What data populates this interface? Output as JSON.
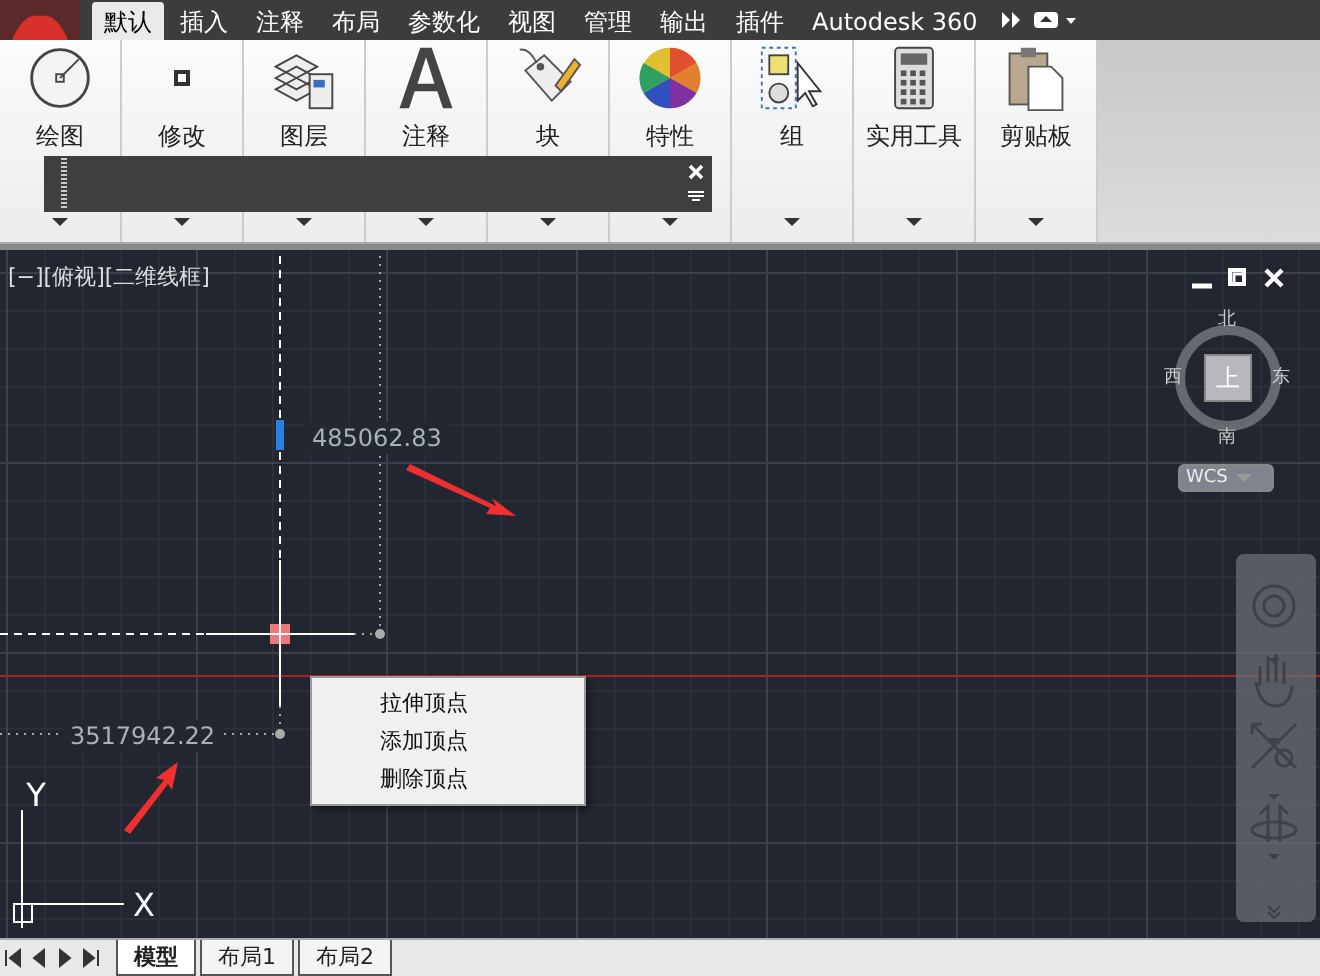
{
  "ribbon_tabs": [
    {
      "label": "默认",
      "selected": true
    },
    {
      "label": "插入",
      "selected": false
    },
    {
      "label": "注释",
      "selected": false
    },
    {
      "label": "布局",
      "selected": false
    },
    {
      "label": "参数化",
      "selected": false
    },
    {
      "label": "视图",
      "selected": false
    },
    {
      "label": "管理",
      "selected": false
    },
    {
      "label": "输出",
      "selected": false
    },
    {
      "label": "插件",
      "selected": false
    },
    {
      "label": "Autodesk 360",
      "selected": false
    }
  ],
  "ribbon_panels": [
    {
      "label": "绘图",
      "kind": "draw"
    },
    {
      "label": "修改",
      "kind": "modify"
    },
    {
      "label": "图层",
      "kind": "layers"
    },
    {
      "label": "注释",
      "kind": "annotate"
    },
    {
      "label": "块",
      "kind": "block"
    },
    {
      "label": "特性",
      "kind": "properties"
    },
    {
      "label": "组",
      "kind": "group"
    },
    {
      "label": "实用工具",
      "kind": "utilities"
    },
    {
      "label": "剪贴板",
      "kind": "clipboard"
    }
  ],
  "viewport": {
    "label": "[−][俯视][二维线框]",
    "compass": {
      "north": "北",
      "south": "南",
      "east": "东",
      "west": "西",
      "face": "上"
    },
    "ucs_menu": "WCS",
    "dimension_inputs": [
      "485062.83",
      "3517942.22"
    ],
    "context_menu": [
      "拉伸顶点",
      "添加顶点",
      "删除顶点"
    ],
    "ucs_axes": {
      "y": "Y",
      "x": "X"
    }
  },
  "layout_tabs": [
    {
      "label": "模型",
      "selected": true
    },
    {
      "label": "布局1",
      "selected": false
    },
    {
      "label": "布局2",
      "selected": false
    }
  ]
}
